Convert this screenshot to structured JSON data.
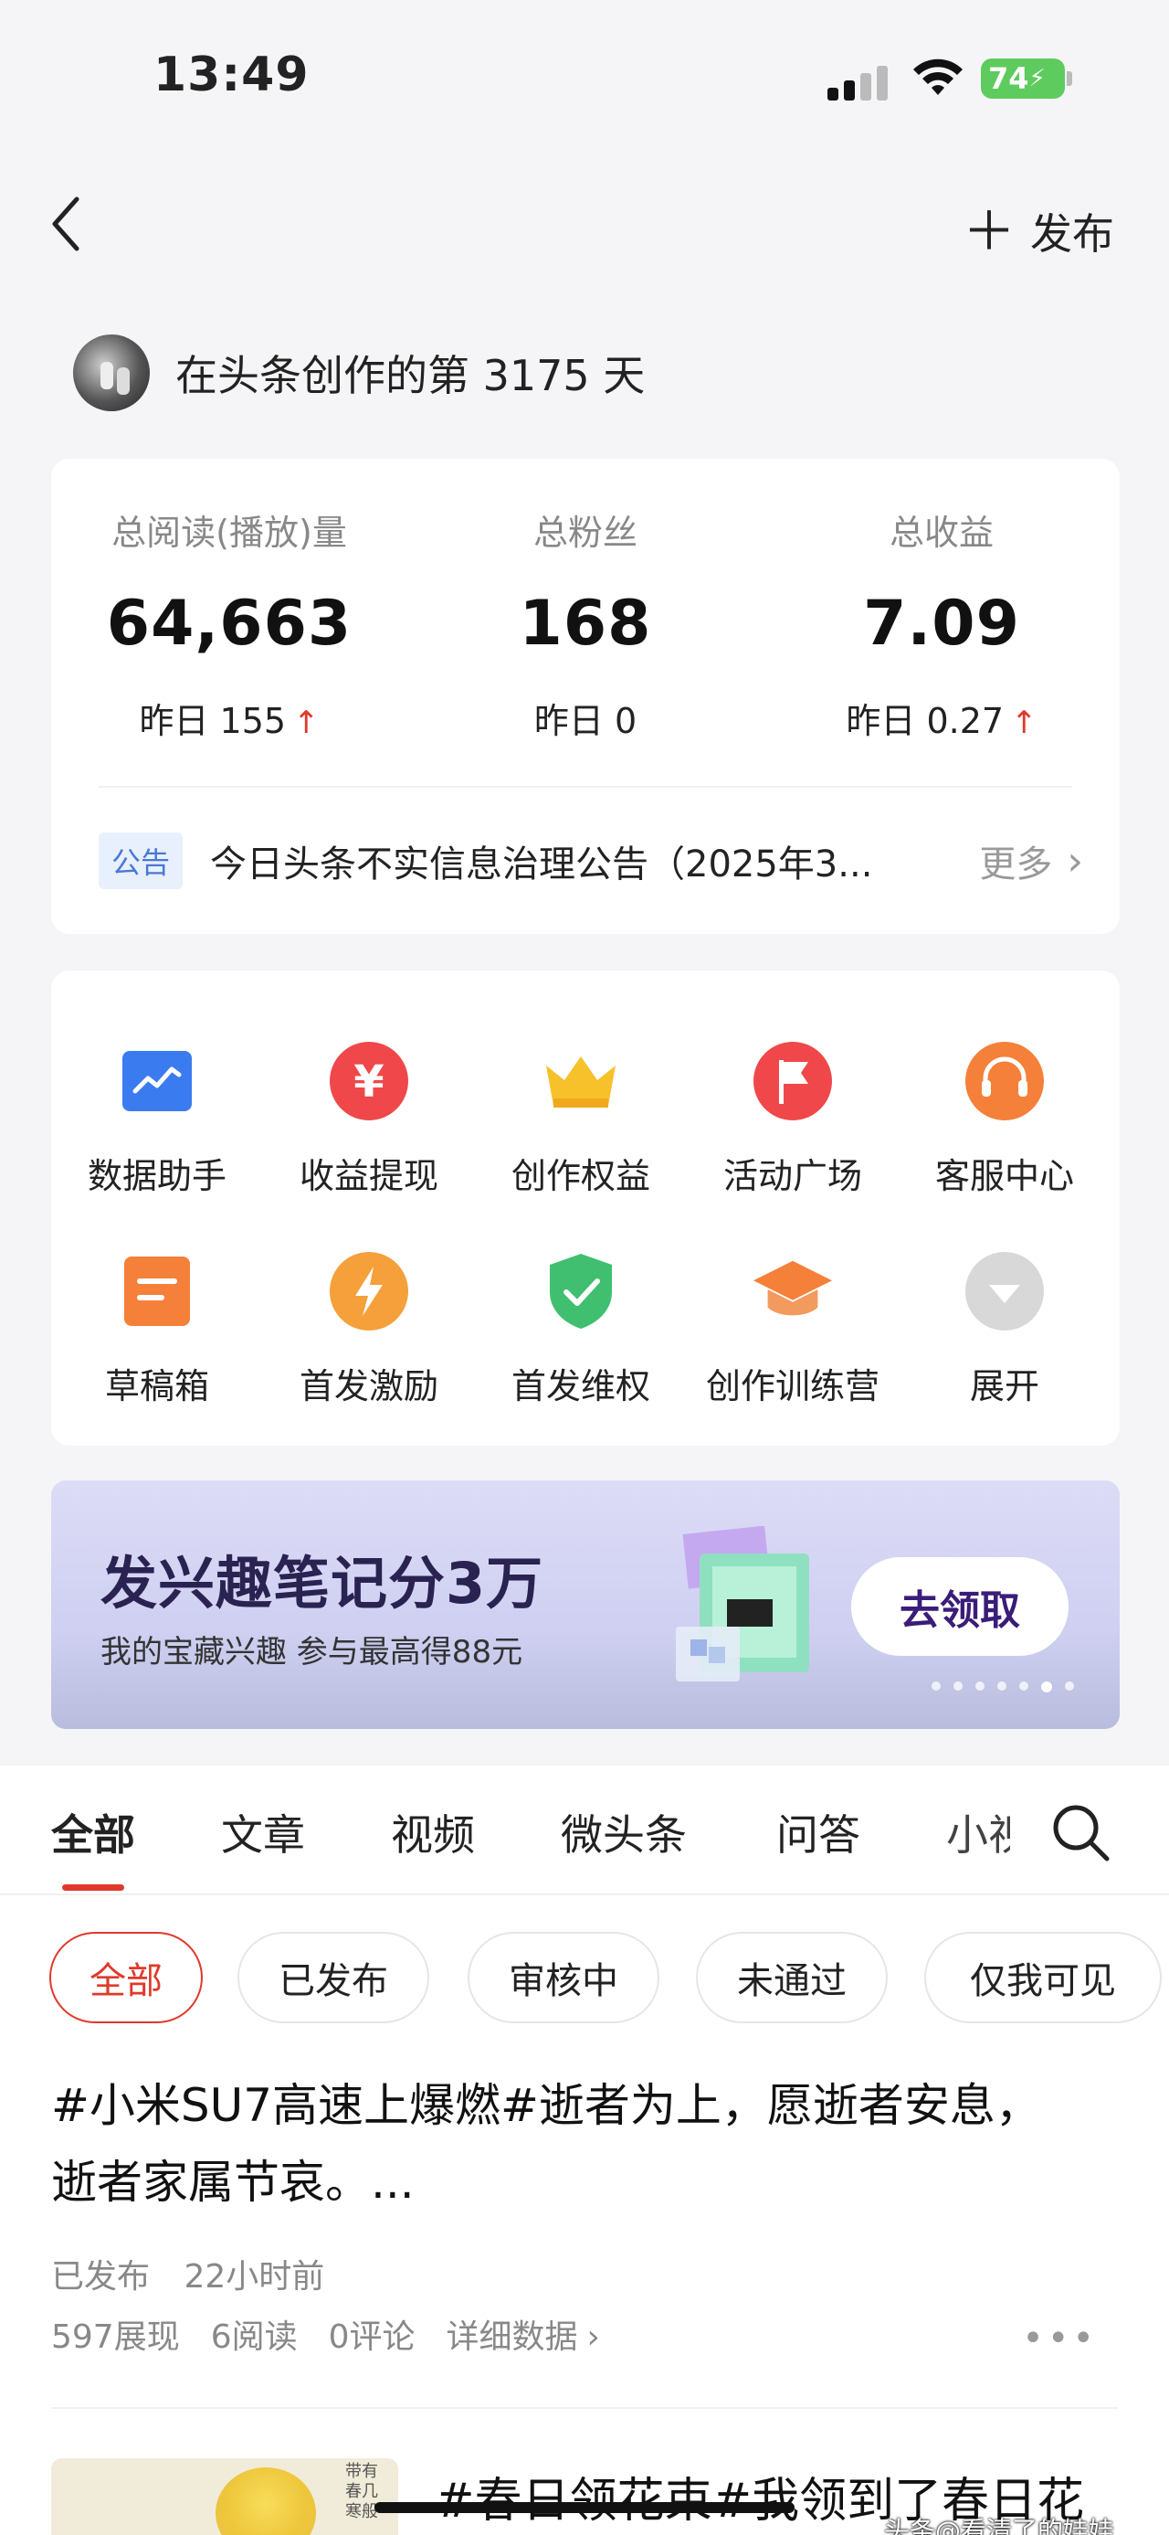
{
  "status_bar": {
    "time": "13:49",
    "battery": "74"
  },
  "nav": {
    "publish_label": "发布"
  },
  "creator": {
    "text": "在头条创作的第 3175 天"
  },
  "stats": [
    {
      "label": "总阅读(播放)量",
      "value": "64,663",
      "delta": "昨日 155",
      "trend": "up"
    },
    {
      "label": "总粉丝",
      "value": "168",
      "delta": "昨日 0",
      "trend": "none"
    },
    {
      "label": "总收益",
      "value": "7.09",
      "delta": "昨日 0.27",
      "trend": "up"
    }
  ],
  "notice": {
    "tag": "公告",
    "text": "今日头条不实信息治理公告（2025年3...",
    "more": "更多"
  },
  "tools": [
    {
      "label": "数据助手",
      "icon": "chart-icon",
      "color": "#3b7bf0"
    },
    {
      "label": "收益提现",
      "icon": "yuan-icon",
      "color": "#f0484a"
    },
    {
      "label": "创作权益",
      "icon": "crown-icon",
      "color": "#f7c12b"
    },
    {
      "label": "活动广场",
      "icon": "flag-icon",
      "color": "#f0484a"
    },
    {
      "label": "客服中心",
      "icon": "headset-icon",
      "color": "#f5803a"
    },
    {
      "label": "草稿箱",
      "icon": "draft-icon",
      "color": "#f5803a"
    },
    {
      "label": "首发激励",
      "icon": "lightning-icon",
      "color": "#f5a03a"
    },
    {
      "label": "首发维权",
      "icon": "shield-icon",
      "color": "#3fbf6f"
    },
    {
      "label": "创作训练营",
      "icon": "graduation-cap-icon",
      "color": "#f5803a"
    },
    {
      "label": "展开",
      "icon": "expand-icon",
      "color": "#d8d8d8"
    }
  ],
  "banner": {
    "title": "发兴趣笔记分3万",
    "subtitle": "我的宝藏兴趣 参与最高得88元",
    "button": "去领取",
    "dots_total": 7,
    "dots_active": 6
  },
  "tabs": [
    "全部",
    "文章",
    "视频",
    "微头条",
    "问答",
    "小视"
  ],
  "filters": [
    "全部",
    "已发布",
    "审核中",
    "未通过",
    "仅我可见"
  ],
  "post": {
    "title": "#小米SU7高速上爆燃#逝者为上，愿逝者安息，逝者家属节哀。...",
    "status": "已发布",
    "time": "22小时前",
    "impressions": "597展现",
    "reads": "6阅读",
    "comments": "0评论",
    "detail": "详细数据"
  },
  "post2": {
    "title": "#春日领花束#我领到了春日花",
    "thumb_text": "带有\n春几\n寒般"
  },
  "watermark": "头条@看清了的娃娃"
}
